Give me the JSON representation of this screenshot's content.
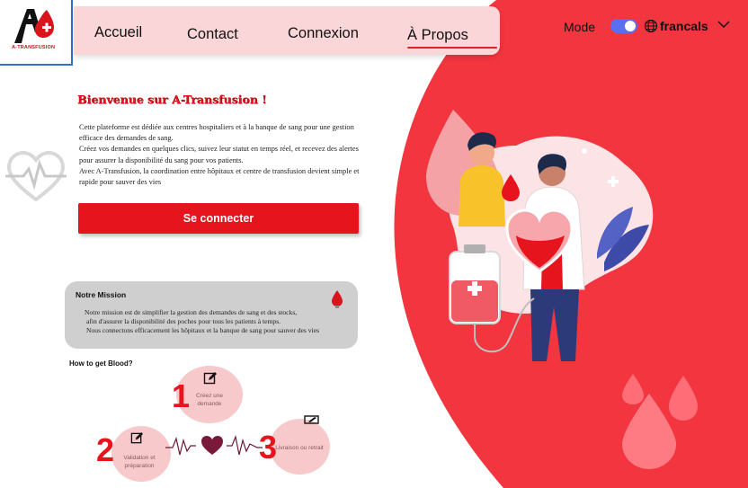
{
  "logo": {
    "text": "A-TRANSFUSION",
    "icon": "blood-a-plus-logo"
  },
  "nav": {
    "items": [
      "Accueil",
      "Contact",
      "Connexion",
      "À Propos"
    ],
    "active": "À Propos"
  },
  "settings": {
    "mode_label": "Mode",
    "mode_toggle_on": true,
    "language": "francals"
  },
  "welcome": {
    "title": "Bienvenue sur A-Transfusion !",
    "paragraphs": [
      "Cette plateforme est dédiée aux centres hospitaliers et à la banque de sang pour une gestion efficace des demandes de sang.",
      "Créez vos demandes en quelques clics, suivez leur statut en temps réel, et recevez des alertes pour assurer la disponibilité du sang pour vos patients.",
      "Avec A-Transfusion, la coordination entre hôpitaux et centre de transfusion devient simple et rapide pour sauver des vies"
    ],
    "button": "Se connecter"
  },
  "mission": {
    "title": "Notre Mission",
    "lines": [
      "Notre mission est de simplifier la gestion des demandes de sang et des stocks,",
      "afin d'assurer la disponibilité des poches pour tous les patients à temps.",
      "Nous connectons efficacement les hôpitaux et la banque de sang pour sauver des vies"
    ]
  },
  "howto": {
    "title": "How to get Blood?",
    "steps": [
      {
        "number": "1",
        "label": "Créez une demande",
        "icon": "edit-icon"
      },
      {
        "number": "2",
        "label": "Validation et préparation",
        "icon": "edit-icon"
      },
      {
        "number": "3",
        "label": "Livraison ou retrait",
        "icon": "truck-icon"
      }
    ]
  },
  "colors": {
    "brand_red": "#e6141d",
    "nav_pink": "#fbd6d8",
    "toggle_blue": "#5b6ef0",
    "mission_gray": "#cfcfcf"
  }
}
